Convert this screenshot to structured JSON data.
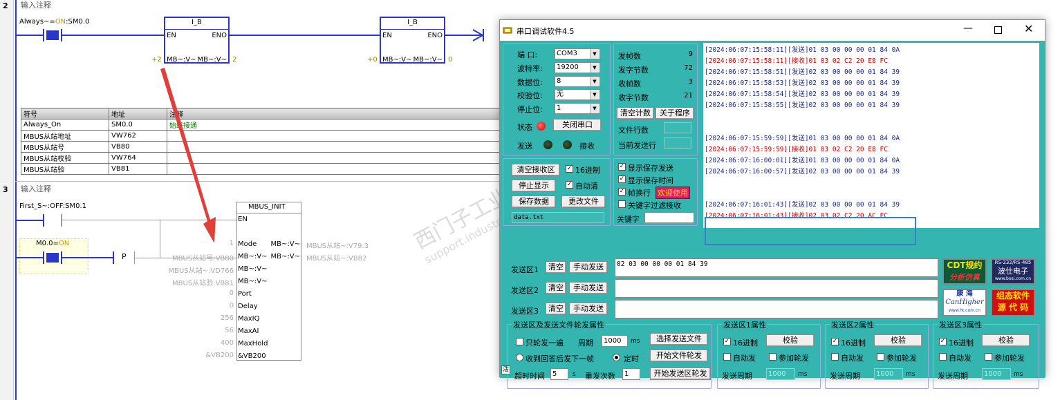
{
  "ladder": {
    "net2": {
      "num": "2",
      "comment": "输入注释"
    },
    "net3": {
      "num": "3",
      "comment": "输入注释"
    },
    "always_contact": {
      "prefix": "Always~=",
      "state": "ON",
      "addr": ":SM0.0"
    },
    "ib1": {
      "title": "I_B",
      "en": "EN",
      "eno": "ENO",
      "in": "MB~:V~",
      "out": "MB~:V~",
      "in_val": "+2",
      "out_val": "2"
    },
    "ib2": {
      "title": "I_B",
      "en": "EN",
      "eno": "ENO",
      "in": "MB~:V~",
      "out": "MB~:V~",
      "in_val": "+0",
      "out_val": "0"
    },
    "symtable": {
      "headers": [
        "符号",
        "地址",
        "注释"
      ],
      "rows": [
        [
          "Always_On",
          "SM0.0",
          "始终接通"
        ],
        [
          "MBUS从站地址",
          "VW762",
          ""
        ],
        [
          "MBUS从站号",
          "VB80",
          ""
        ],
        [
          "MBUS从站校验",
          "VW764",
          ""
        ],
        [
          "MBUS从站验",
          "VB81",
          ""
        ]
      ]
    },
    "first_contact": {
      "label": "First_S~:OFF:SM0.1"
    },
    "m00": {
      "prefix": "M0.0=",
      "state": "ON"
    },
    "p_label": "P",
    "init": {
      "title": "MBUS_INIT",
      "en": "EN",
      "pins_left": [
        "Mode",
        "MB~:V~",
        "MB~:V~",
        "MB~:V~",
        "Port",
        "Delay",
        "MaxIQ",
        "MaxAI",
        "MaxHold",
        "&VB200"
      ],
      "vals_left": [
        "1",
        "MBUS从站号:VB80",
        "MBUS从站~:VD766",
        "MBUS从站验:VB81",
        "0",
        "0",
        "256",
        "56",
        "400",
        "&VB200"
      ],
      "pins_right": [
        "MB~:V~",
        "MB~:V~"
      ],
      "vals_right": [
        "MBUS从站~:V79.3",
        "MBUS从站~:VB82"
      ]
    }
  },
  "serial": {
    "title": "串口调试软件4.5",
    "port": {
      "port_label": "端  口:",
      "port": "COM3",
      "baud_label": "波特率:",
      "baud": "19200",
      "data_label": "数据位:",
      "data": "8",
      "parity_label": "校验位:",
      "parity": "无",
      "stop_label": "停止位:",
      "stop": "1",
      "status_label": "状态",
      "close_btn": "关闭串口",
      "send_label": "发送",
      "recv_label": "接收"
    },
    "stats": {
      "tx_frames_label": "发帧数",
      "tx_frames": "9",
      "tx_bytes_label": "发字节数",
      "tx_bytes": "72",
      "rx_frames_label": "收帧数",
      "rx_frames": "3",
      "rx_bytes_label": "收字节数",
      "rx_bytes": "21",
      "clear_btn": "清空计数",
      "about_btn": "关于程序",
      "file_lines_label": "文件行数",
      "cur_line_label": "当前发送行"
    },
    "recv_ctrl": {
      "clear_btn": "清空接收区",
      "hex_label": "16进制",
      "stop_btn": "停止显示",
      "autoclear_label": "自动清",
      "save_btn": "保存数据",
      "change_btn": "更改文件",
      "filename": "data.txt"
    },
    "disp_opts": {
      "show_send": "显示保存发送",
      "show_time": "显示保存时间",
      "wrap": "帧换行",
      "welcome": "欢迎使用",
      "kw_filter": "关键字过滤接收",
      "kw_label": "关键字"
    },
    "log": [
      {
        "t": "[2024:06:07:15:58:11][发送]01 03 00 00 00 01 84 0A",
        "rx": false
      },
      {
        "t": "[2024:06:07:15:58:11][接收]01 03 02 C2 20 E8 FC",
        "rx": true
      },
      {
        "t": "[2024:06:07:15:58:51][发送]02 03 00 00 00 01 84 39",
        "rx": false
      },
      {
        "t": "[2024:06:07:15:58:53][发送]02 03 00 00 00 01 84 39",
        "rx": false
      },
      {
        "t": "[2024:06:07:15:58:54][发送]02 03 00 00 00 01 84 39",
        "rx": false
      },
      {
        "t": "[2024:06:07:15:58:55][发送]02 03 00 00 00 01 84 39",
        "rx": false
      },
      {
        "t": "",
        "rx": false
      },
      {
        "t": "",
        "rx": false
      },
      {
        "t": "[2024:06:07:15:59:59][发送]01 03 00 00 00 01 84 0A",
        "rx": false
      },
      {
        "t": "[2024:06:07:15:59:59][接收]01 03 02 C2 20 E8 FC",
        "rx": true
      },
      {
        "t": "[2024:06:07:16:00:01][发送]01 03 00 00 00 01 84 0A",
        "rx": false
      },
      {
        "t": "[2024:06:07:16:00:57][发送]02 03 00 00 00 01 84 39",
        "rx": false
      },
      {
        "t": "",
        "rx": false
      },
      {
        "t": "",
        "rx": false
      },
      {
        "t": "[2024:06:07:16:01:43][发送]02 03 00 00 00 01 84 39",
        "rx": false
      },
      {
        "t": "[2024:06:07:16:01:43][接收]02 03 02 C2 20 AC FC",
        "rx": true
      }
    ],
    "send_areas": [
      {
        "label": "发送区1",
        "clear": "清空",
        "manual": "手动发送",
        "content": "02 03 00 00 00 01 84 39"
      },
      {
        "label": "发送区2",
        "clear": "清空",
        "manual": "手动发送",
        "content": ""
      },
      {
        "label": "发送区3",
        "clear": "清空",
        "manual": "手动发送",
        "content": ""
      }
    ],
    "ads": {
      "ad1_l1": "CDT规约",
      "ad1_l2": "分析仿真",
      "ad2_l0": "RS-232/RS-485",
      "ad2_l1": "波仕电子",
      "ad2_l2": "www.bosi.com.cn",
      "ad3_l1": "康 海",
      "ad3_l2": "CanHigher",
      "ad3_l3": "www.ht.com.cn",
      "ad4_l1": "组态软件",
      "ad4_l2": "源 代 码"
    },
    "poll": {
      "title": "发送区及发送文件轮发属性",
      "once": "只轮发一遍",
      "period_label": "周期",
      "period": "1000",
      "ms": "ms",
      "sel_file": "选择发送文件",
      "after_reply": "收到回答后发下一帧",
      "timed": "定时",
      "start_file": "开始文件轮发",
      "timeout_label": "超时时间",
      "timeout": "5",
      "s": "s",
      "retry_label": "重发次数",
      "retry": "1",
      "start_area": "开始发送区轮发"
    },
    "area_props": [
      {
        "title": "发送区1属性",
        "hex": "16进制",
        "verify": "校验",
        "auto": "自动发",
        "join": "参加轮发",
        "period_label": "发送周期",
        "period": "1000",
        "ms": "ms"
      },
      {
        "title": "发送区2属性",
        "hex": "16进制",
        "verify": "校验",
        "auto": "自动发",
        "join": "参加轮发",
        "period_label": "发送周期",
        "period": "1000",
        "ms": "ms"
      },
      {
        "title": "发送区3属性",
        "hex": "16进制",
        "verify": "校验",
        "auto": "自动发",
        "join": "参加轮发",
        "period_label": "发送周期",
        "period": "1000",
        "ms": "ms"
      }
    ],
    "status_bar": "活"
  },
  "watermark": {
    "line1": "西门子工业技术论坛",
    "line2": "support.industry.siemens.com/cs"
  },
  "colors": {
    "rail": "#2a36c8",
    "window_bg": "#35b5b0",
    "arrow": "#e0403a",
    "rx_text": "#c00000",
    "tx_text": "#1a2a80"
  }
}
